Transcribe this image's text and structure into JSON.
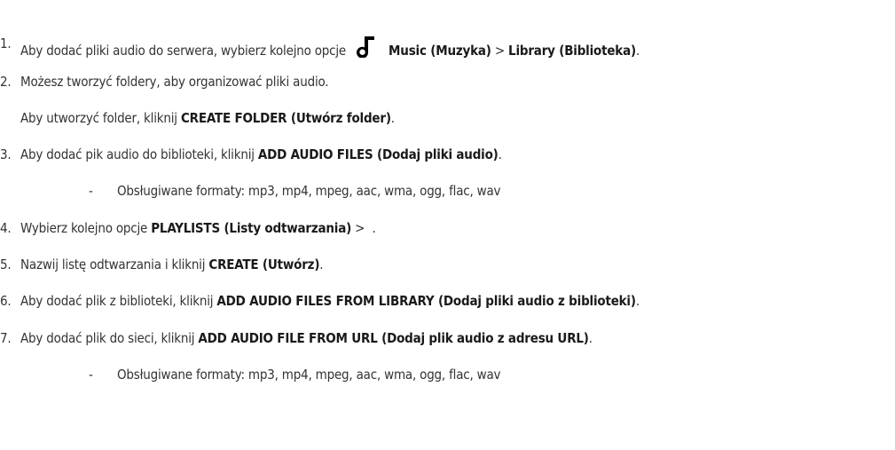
{
  "steps": [
    {
      "number": "1.",
      "text_a": "Aby dodać pliki audio do serwera, wybierz kolejno opcje",
      "icon": "music-note-icon",
      "bold_a": "Music (Muzyka)",
      "sep": ">",
      "bold_b": "Library (Biblioteka)",
      "end": "."
    },
    {
      "number": "2.",
      "text": "Możesz tworzyć foldery, aby organizować pliki audio."
    },
    {
      "text_a": "Aby utworzyć folder, kliknij",
      "bold": "CREATE FOLDER (Utwórz folder)",
      "end": "."
    },
    {
      "number": "3.",
      "text_a": "Aby dodać pik audio do biblioteki, kliknij",
      "bold": "ADD AUDIO FILES (Dodaj pliki audio)",
      "end": "."
    },
    {
      "dash": "-",
      "text": "Obsługiwane formaty: mp3, mp4, mpeg, aac, wma, ogg, flac, wav"
    },
    {
      "number": "4.",
      "text_a": "Wybierz kolejno opcje",
      "bold": "PLAYLISTS (Listy odtwarzania)",
      "end": " >  ."
    },
    {
      "number": "5.",
      "text_a": "Nazwij listę odtwarzania i kliknij",
      "bold": "CREATE (Utwórz)",
      "end": "."
    },
    {
      "number": "6.",
      "text_a": "Aby dodać plik z biblioteki, kliknij",
      "bold": "ADD AUDIO FILES FROM LIBRARY (Dodaj pliki audio z biblioteki)",
      "end": "."
    },
    {
      "number": "7.",
      "text_a": "Aby dodać plik do sieci, kliknij",
      "bold": "ADD AUDIO FILE FROM URL (Dodaj plik audio z adresu URL)",
      "end": "."
    },
    {
      "dash": "-",
      "text": "Obsługiwane formaty: mp3, mp4, mpeg, aac, wma, ogg, flac, wav"
    }
  ]
}
